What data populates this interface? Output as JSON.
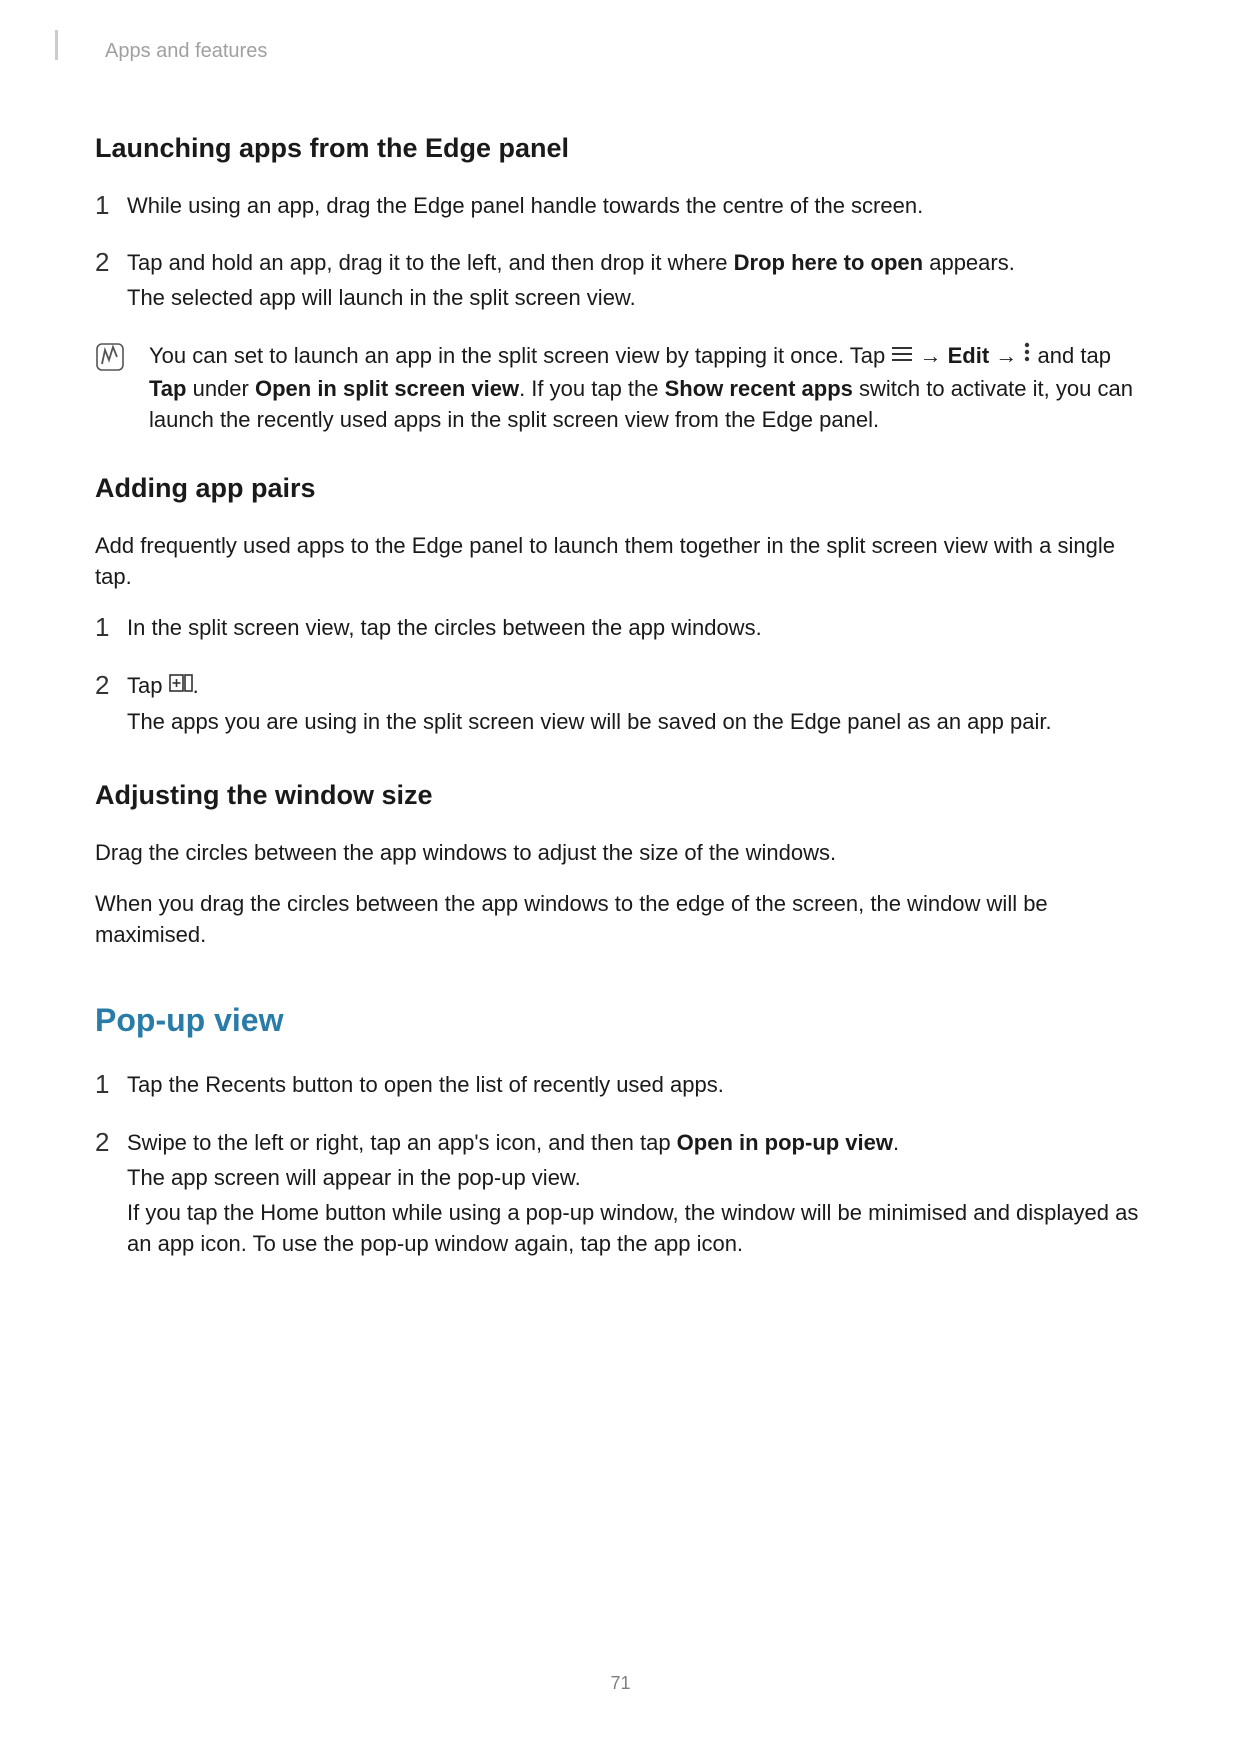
{
  "header": {
    "running_title": "Apps and features"
  },
  "sections": {
    "launching": {
      "heading": "Launching apps from the Edge panel",
      "step1": "While using an app, drag the Edge panel handle towards the centre of the screen.",
      "step2": {
        "pre": "Tap and hold an app, drag it to the left, and then drop it where ",
        "bold": "Drop here to open",
        "post": " appears.",
        "line2": "The selected app will launch in the split screen view."
      },
      "note": {
        "part1a": "You can set to launch an app in the split screen view by tapping it once. Tap ",
        "part1b": " → ",
        "bold_edit": "Edit",
        "part2a": " → ",
        "part2b": " and tap ",
        "bold_tap": "Tap",
        "part2c": " under ",
        "bold_open": "Open in split screen view",
        "part2d": ". If you tap the ",
        "bold_show": "Show recent apps",
        "part3": " switch to activate it, you can launch the recently used apps in the split screen view from the Edge panel."
      }
    },
    "adding": {
      "heading": "Adding app pairs",
      "intro": "Add frequently used apps to the Edge panel to launch them together in the split screen view with a single tap.",
      "step1": "In the split screen view, tap the circles between the app windows.",
      "step2": {
        "pre": "Tap ",
        "post": ".",
        "line2": "The apps you are using in the split screen view will be saved on the Edge panel as an app pair."
      }
    },
    "adjusting": {
      "heading": "Adjusting the window size",
      "p1": "Drag the circles between the app windows to adjust the size of the windows.",
      "p2": "When you drag the circles between the app windows to the edge of the screen, the window will be maximised."
    },
    "popup": {
      "heading": "Pop-up view",
      "step1": "Tap the Recents button to open the list of recently used apps.",
      "step2": {
        "pre": "Swipe to the left or right, tap an app's icon, and then tap ",
        "bold": "Open in pop-up view",
        "post": ".",
        "line2": "The app screen will appear in the pop-up view.",
        "line3": "If you tap the Home button while using a pop-up window, the window will be minimised and displayed as an app icon. To use the pop-up window again, tap the app icon."
      }
    }
  },
  "page_number": "71"
}
